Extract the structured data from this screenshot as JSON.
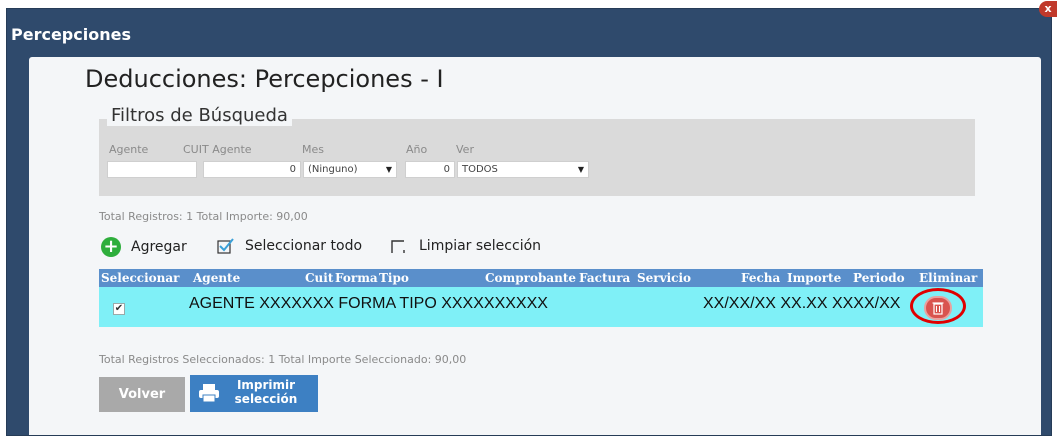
{
  "window": {
    "title": "Percepciones",
    "close_label": "x"
  },
  "page": {
    "heading": "Deducciones: Percepciones - I"
  },
  "filters": {
    "legend": "Filtros de Búsqueda",
    "agente": {
      "label": "Agente",
      "value": ""
    },
    "cuit": {
      "label": "CUIT Agente",
      "value": "0"
    },
    "mes": {
      "label": "Mes",
      "value": "(Ninguno)"
    },
    "anio": {
      "label": "Año",
      "value": "0"
    },
    "ver": {
      "label": "Ver",
      "value": "TODOS"
    }
  },
  "totals": {
    "top": "Total Registros:  1 Total Importe:  90,00",
    "selected": "Total Registros Seleccionados:  1 Total Importe Seleccionado:  90,00"
  },
  "toolbar": {
    "add_label": "Agregar",
    "select_all_label": "Seleccionar todo",
    "clear_label": "Limpiar selección"
  },
  "grid": {
    "columns": [
      "Seleccionar",
      "Agente",
      "Cuit",
      "Forma",
      "Tipo",
      "Comprobante",
      "Factura",
      "Servicio",
      "Fecha",
      "Importe",
      "Periodo",
      "Eliminar"
    ],
    "rows": [
      {
        "main": "AGENTE XXXXXXX FORMA TIPO XXXXXXXXXX",
        "right": "XX/XX/XX XX.XX XXXX/XX",
        "selected": true
      }
    ]
  },
  "buttons": {
    "volver": "Volver",
    "imprimir": "Imprimir selección"
  },
  "colors": {
    "header": "#5a8fcb",
    "row": "#7ff0f7",
    "titlebar": "#2f4a6c",
    "add": "#2eae3c",
    "delete": "#d9534f"
  }
}
